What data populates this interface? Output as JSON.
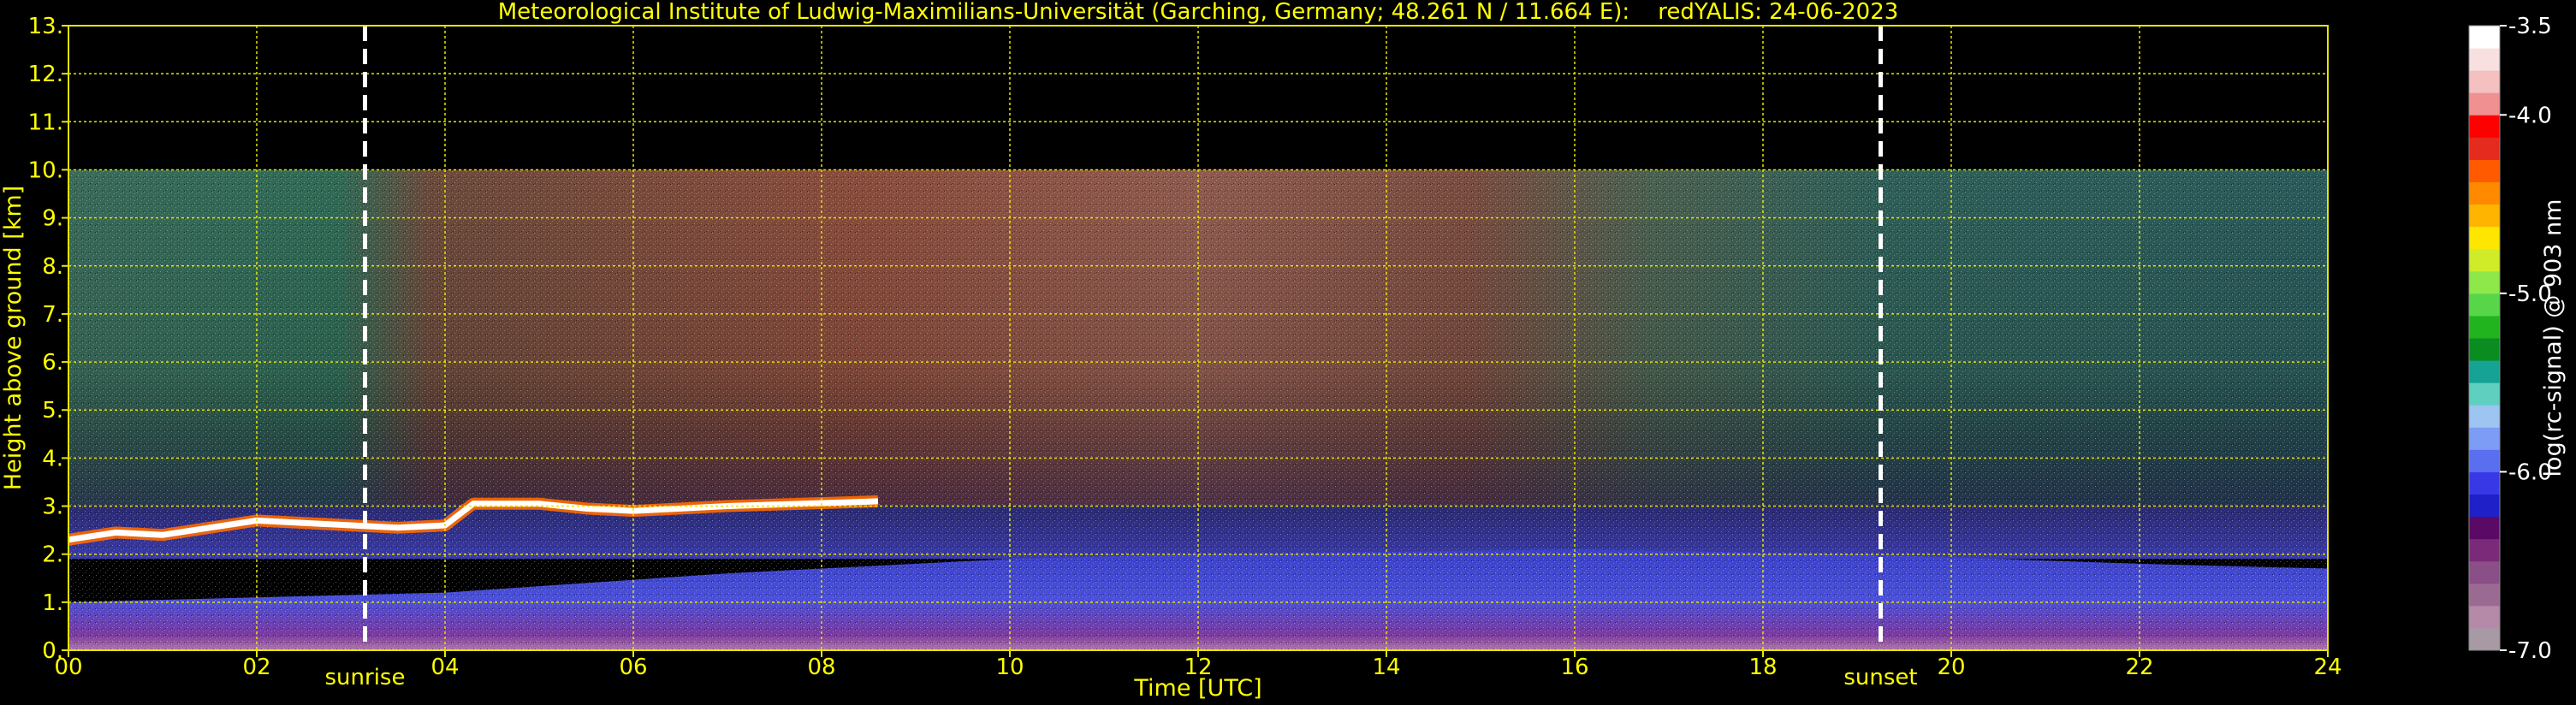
{
  "chart_data": {
    "type": "heatmap",
    "title": "Meteorological Institute of Ludwig-Maximilians-Universität (Garching, Germany; 48.261 N / 11.664 E):    redYALIS: 24-06-2023",
    "xlabel": "Time [UTC]",
    "ylabel": "Height above ground [km]",
    "xlim": [
      0,
      24
    ],
    "ylim": [
      0,
      13
    ],
    "x_ticks": [
      "00",
      "02",
      "04",
      "06",
      "08",
      "10",
      "12",
      "14",
      "16",
      "18",
      "20",
      "22",
      "24"
    ],
    "y_ticks": [
      "0.",
      "1.",
      "2.",
      "3.",
      "4.",
      "5.",
      "6.",
      "7.",
      "8.",
      "9.",
      "10.",
      "11.",
      "12.",
      "13."
    ],
    "grid": true,
    "data_top_km": 10,
    "events": [
      {
        "label": "sunrise",
        "time": 3.15
      },
      {
        "label": "sunset",
        "time": 19.25
      }
    ],
    "colorbar": {
      "label": "log(rc-signal) @ 903 nm",
      "range": [
        -7.0,
        -3.5
      ],
      "ticks": [
        "-3.5",
        "-4.0",
        "-5.0",
        "-6.0",
        "-7.0"
      ],
      "tick_values": [
        -3.5,
        -4.0,
        -5.0,
        -6.0,
        -7.0
      ],
      "colors": [
        "#a89aa5",
        "#b58aa8",
        "#9a6a93",
        "#8a4f86",
        "#7a2a78",
        "#5a0a64",
        "#2020c8",
        "#3838e6",
        "#5a6ef0",
        "#7c9cf5",
        "#9ec4f2",
        "#5fd0c0",
        "#16a294",
        "#0a8c20",
        "#22b41e",
        "#58d64a",
        "#8ee84a",
        "#d0ec28",
        "#ffe600",
        "#ffb400",
        "#ff8a00",
        "#ff5a00",
        "#e52a1e",
        "#ff0000",
        "#f09090",
        "#f4c0c0",
        "#f8e0e0",
        "#ffffff"
      ]
    },
    "cloud_layer": [
      {
        "t": 0.0,
        "h": 2.3
      },
      {
        "t": 0.5,
        "h": 2.45
      },
      {
        "t": 1.0,
        "h": 2.4
      },
      {
        "t": 1.5,
        "h": 2.55
      },
      {
        "t": 2.0,
        "h": 2.7
      },
      {
        "t": 2.5,
        "h": 2.65
      },
      {
        "t": 3.0,
        "h": 2.6
      },
      {
        "t": 3.5,
        "h": 2.55
      },
      {
        "t": 4.0,
        "h": 2.6
      },
      {
        "t": 4.3,
        "h": 3.05
      },
      {
        "t": 5.0,
        "h": 3.05
      },
      {
        "t": 5.5,
        "h": 2.95
      },
      {
        "t": 6.0,
        "h": 2.9
      },
      {
        "t": 6.5,
        "h": 2.95
      },
      {
        "t": 7.0,
        "h": 3.0
      },
      {
        "t": 7.8,
        "h": 3.05
      },
      {
        "t": 8.6,
        "h": 3.1
      }
    ],
    "boundary_layer_top": [
      {
        "t": 0,
        "h": 1.0
      },
      {
        "t": 4,
        "h": 1.2
      },
      {
        "t": 7,
        "h": 1.6
      },
      {
        "t": 10,
        "h": 1.9
      },
      {
        "t": 12,
        "h": 2.0
      },
      {
        "t": 16,
        "h": 2.1
      },
      {
        "t": 19,
        "h": 2.0
      },
      {
        "t": 22,
        "h": 1.8
      },
      {
        "t": 24,
        "h": 1.7
      }
    ]
  }
}
